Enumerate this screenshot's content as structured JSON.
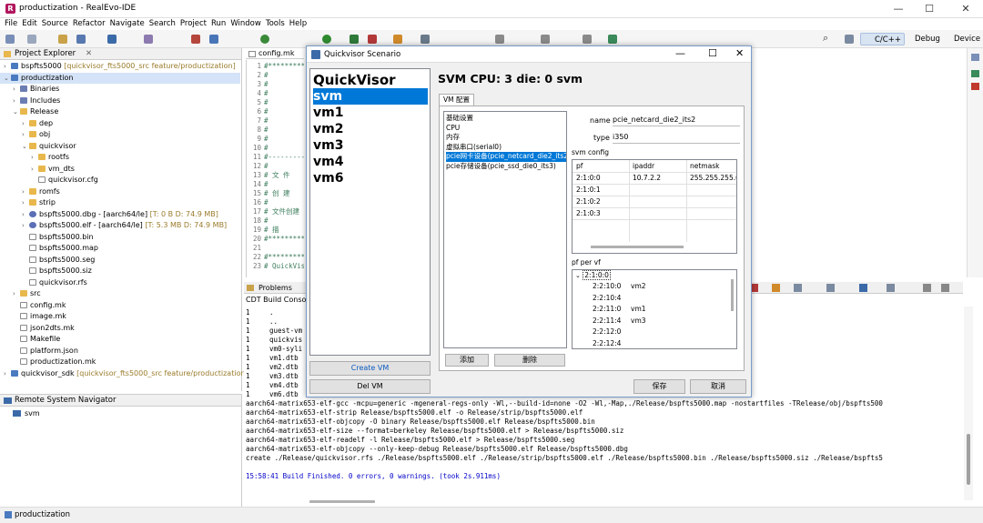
{
  "window": {
    "title": "productization - RealEvo-IDE",
    "minimize": "—",
    "maximize": "☐",
    "close": "✕"
  },
  "menu": [
    "File",
    "Edit",
    "Source",
    "Refactor",
    "Navigate",
    "Search",
    "Project",
    "Run",
    "Window",
    "Tools",
    "Help"
  ],
  "perspectives": {
    "cpp": "C/C++",
    "debug": "Debug",
    "device": "Device"
  },
  "project_explorer": {
    "title": "Project Explorer",
    "rows": [
      {
        "indent": 0,
        "twist": "›",
        "icon": "proj",
        "label": "bspfts5000",
        "deco": " [quickvisor_fts5000_src feature/productization]"
      },
      {
        "indent": 0,
        "twist": "⌄",
        "icon": "proj",
        "label": "productization",
        "deco": "",
        "selected": true
      },
      {
        "indent": 1,
        "twist": "›",
        "icon": "bin",
        "label": "Binaries",
        "deco": ""
      },
      {
        "indent": 1,
        "twist": "›",
        "icon": "bin",
        "label": "Includes",
        "deco": ""
      },
      {
        "indent": 1,
        "twist": "⌄",
        "icon": "folder",
        "label": "Release",
        "deco": ""
      },
      {
        "indent": 2,
        "twist": "›",
        "icon": "folder",
        "label": "dep",
        "deco": ""
      },
      {
        "indent": 2,
        "twist": "›",
        "icon": "folder",
        "label": "obj",
        "deco": ""
      },
      {
        "indent": 2,
        "twist": "⌄",
        "icon": "folder",
        "label": "quickvisor",
        "deco": ""
      },
      {
        "indent": 3,
        "twist": "›",
        "icon": "folder",
        "label": "rootfs",
        "deco": ""
      },
      {
        "indent": 3,
        "twist": "›",
        "icon": "folder",
        "label": "vm_dts",
        "deco": ""
      },
      {
        "indent": 3,
        "twist": "",
        "icon": "file",
        "label": "quickvisor.cfg",
        "deco": ""
      },
      {
        "indent": 2,
        "twist": "›",
        "icon": "folder",
        "label": "romfs",
        "deco": ""
      },
      {
        "indent": 2,
        "twist": "›",
        "icon": "folder",
        "label": "strip",
        "deco": ""
      },
      {
        "indent": 2,
        "twist": "›",
        "icon": "gear",
        "label": "bspfts5000.dbg - [aarch64/le]",
        "deco": " [T: 0 B  D: 74.9 MB]"
      },
      {
        "indent": 2,
        "twist": "›",
        "icon": "gear",
        "label": "bspfts5000.elf - [aarch64/le]",
        "deco": " [T: 5.3 MB  D: 74.9 MB]"
      },
      {
        "indent": 2,
        "twist": "",
        "icon": "file",
        "label": "bspfts5000.bin",
        "deco": ""
      },
      {
        "indent": 2,
        "twist": "",
        "icon": "file",
        "label": "bspfts5000.map",
        "deco": ""
      },
      {
        "indent": 2,
        "twist": "",
        "icon": "file",
        "label": "bspfts5000.seg",
        "deco": ""
      },
      {
        "indent": 2,
        "twist": "",
        "icon": "file",
        "label": "bspfts5000.siz",
        "deco": ""
      },
      {
        "indent": 2,
        "twist": "",
        "icon": "file",
        "label": "quickvisor.rfs",
        "deco": ""
      },
      {
        "indent": 1,
        "twist": "›",
        "icon": "folder",
        "label": "src",
        "deco": ""
      },
      {
        "indent": 1,
        "twist": "",
        "icon": "file",
        "label": "config.mk",
        "deco": ""
      },
      {
        "indent": 1,
        "twist": "",
        "icon": "file",
        "label": "image.mk",
        "deco": ""
      },
      {
        "indent": 1,
        "twist": "",
        "icon": "file",
        "label": "json2dts.mk",
        "deco": ""
      },
      {
        "indent": 1,
        "twist": "",
        "icon": "file",
        "label": "Makefile",
        "deco": ""
      },
      {
        "indent": 1,
        "twist": "",
        "icon": "file",
        "label": "platform.json",
        "deco": ""
      },
      {
        "indent": 1,
        "twist": "",
        "icon": "file",
        "label": "productization.mk",
        "deco": ""
      },
      {
        "indent": 0,
        "twist": "›",
        "icon": "proj",
        "label": "quickvisor_sdk",
        "deco": " [quickvisor_fts5000_src feature/productization]"
      }
    ]
  },
  "remote_nav": {
    "title": "Remote System Navigator",
    "item": "svm"
  },
  "editor": {
    "tab": "config.mk",
    "lines": [
      {
        "n": "1",
        "t": "#**********"
      },
      {
        "n": "2",
        "t": "#"
      },
      {
        "n": "3",
        "t": "#"
      },
      {
        "n": "4",
        "t": "#"
      },
      {
        "n": "5",
        "t": "#"
      },
      {
        "n": "6",
        "t": "#"
      },
      {
        "n": "7",
        "t": "#"
      },
      {
        "n": "8",
        "t": "#"
      },
      {
        "n": "9",
        "t": "#"
      },
      {
        "n": "10",
        "t": "#"
      },
      {
        "n": "11",
        "t": "#----------"
      },
      {
        "n": "12",
        "t": "#"
      },
      {
        "n": "13",
        "t": "# 文  件"
      },
      {
        "n": "14",
        "t": "#"
      },
      {
        "n": "15",
        "t": "# 创   建"
      },
      {
        "n": "16",
        "t": "#"
      },
      {
        "n": "17",
        "t": "# 文件创建"
      },
      {
        "n": "18",
        "t": "#"
      },
      {
        "n": "19",
        "t": "# 描"
      },
      {
        "n": "20",
        "t": "#**********"
      },
      {
        "n": "21",
        "t": ""
      },
      {
        "n": "22",
        "t": "#**********"
      },
      {
        "n": "23",
        "t": "# QuickVisor"
      }
    ]
  },
  "console": {
    "tabs": {
      "problems": "Problems",
      "console": "CDT Build Console"
    },
    "short_lines": [
      {
        "n": "1",
        "t": "."
      },
      {
        "n": "1",
        "t": ".."
      },
      {
        "n": "1",
        "t": "guest-vm"
      },
      {
        "n": "1",
        "t": "quickvis"
      },
      {
        "n": "1",
        "t": "vm0-syli"
      },
      {
        "n": "1",
        "t": "vm1.dtb"
      },
      {
        "n": "1",
        "t": "vm2.dtb"
      },
      {
        "n": "1",
        "t": "vm3.dtb"
      },
      {
        "n": "1",
        "t": "vm4.dtb"
      },
      {
        "n": "1",
        "t": "vm6.dtb"
      }
    ],
    "lines": [
      "aarch64-matrix653-elf-gcc -mcpu=generic -mgeneral-regs-only -Wl,--build-id=none -O2  -Wl,-Map,./Release/bspfts5000.map -nostartfiles -TRelease/obj/bspfts500",
      "aarch64-matrix653-elf-strip  Release/bspfts5000.elf -o Release/strip/bspfts5000.elf",
      "aarch64-matrix653-elf-objcopy -O binary Release/bspfts5000.elf Release/bspfts5000.bin",
      "aarch64-matrix653-elf-size --format=berkeley Release/bspfts5000.elf > Release/bspfts5000.siz",
      "aarch64-matrix653-elf-readelf -l Release/bspfts5000.elf > Release/bspfts5000.seg",
      "aarch64-matrix653-elf-objcopy --only-keep-debug Release/bspfts5000.elf Release/bspfts5000.dbg",
      "create ./Release/quickvisor.rfs  ./Release/bspfts5000.elf ./Release/strip/bspfts5000.elf ./Release/bspfts5000.bin ./Release/bspfts5000.siz ./Release/bspfts5",
      "",
      "15:58:41 Build Finished. 0 errors, 0 warnings. (took 2s.911ms)"
    ],
    "finished_color": "#0000c8"
  },
  "dialog": {
    "title": "Quickvisor Scenario",
    "vm_list": [
      "QuickVisor",
      "svm",
      "vm1",
      "vm2",
      "vm3",
      "vm4",
      "vm6"
    ],
    "selected_vm": "svm",
    "create_vm": "Create VM",
    "del_vm": "Del VM",
    "heading": "SVM CPU: 3 die: 0 svm",
    "tab": "VM 配置",
    "config_items": [
      "基础设置",
      "CPU",
      "内存",
      "虚拟串口(serial0)",
      "pcie网卡设备(pcie_netcard_die2_its2)",
      "pcie存储设备(pcie_ssd_die0_its3)"
    ],
    "selected_config": "pcie网卡设备(pcie_netcard_die2_its2)",
    "add": "添加",
    "delete": "删除",
    "name_label": "name",
    "name_value": "pcie_netcard_die2_its2",
    "type_label": "type",
    "type_value": "i350",
    "svm_config_label": "svm config",
    "svm_config": {
      "headers": [
        "pf",
        "ipaddr",
        "netmask"
      ],
      "rows": [
        [
          "2:1:0:0",
          "10.7.2.2",
          "255.255.255.0"
        ],
        [
          "2:1:0:1",
          "",
          ""
        ],
        [
          "2:1:0:2",
          "",
          ""
        ],
        [
          "2:1:0:3",
          "",
          ""
        ]
      ]
    },
    "pf_per_vf_label": "pf per vf",
    "pf_tree": {
      "root": "2:1:0:0",
      "rows": [
        [
          "2:2:10:0",
          "vm2"
        ],
        [
          "2:2:10:4",
          ""
        ],
        [
          "2:2:11:0",
          "vm1"
        ],
        [
          "2:2:11:4",
          "vm3"
        ],
        [
          "2:2:12:0",
          ""
        ],
        [
          "2:2:12:4",
          ""
        ]
      ]
    },
    "save": "保存",
    "cancel": "取消"
  },
  "status": {
    "text": "productization"
  },
  "colors": {
    "accent": "#0078d7",
    "decoration": "#9a7b2a",
    "comment": "#3f7f5f"
  }
}
